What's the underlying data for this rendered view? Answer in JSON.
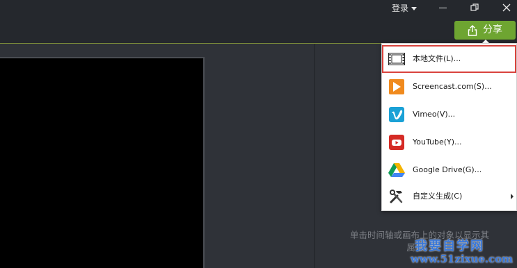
{
  "titlebar": {
    "login_label": "登录",
    "share_label": "分享"
  },
  "share_menu": {
    "items": [
      {
        "label": "本地文件(L)...",
        "icon": "film-icon"
      },
      {
        "label": "Screencast.com(S)...",
        "icon": "screencast-icon",
        "color": "#f08a1e"
      },
      {
        "label": "Vimeo(V)...",
        "icon": "vimeo-icon",
        "color": "#1aa1d6"
      },
      {
        "label": "YouTube(Y)...",
        "icon": "youtube-icon",
        "color": "#d52b25"
      },
      {
        "label": "Google Drive(G)...",
        "icon": "google-drive-icon"
      },
      {
        "label": "自定义生成(C)",
        "icon": "tools-icon"
      }
    ]
  },
  "properties": {
    "hint": "单击时间轴或画布上的对象以显示其属性。"
  },
  "watermark": {
    "cn": "我要自学网",
    "url": "www.51zixue.com"
  },
  "colors": {
    "accent_green": "#6ea531",
    "selected_outline": "#d9433d",
    "background": "#2f3238"
  }
}
